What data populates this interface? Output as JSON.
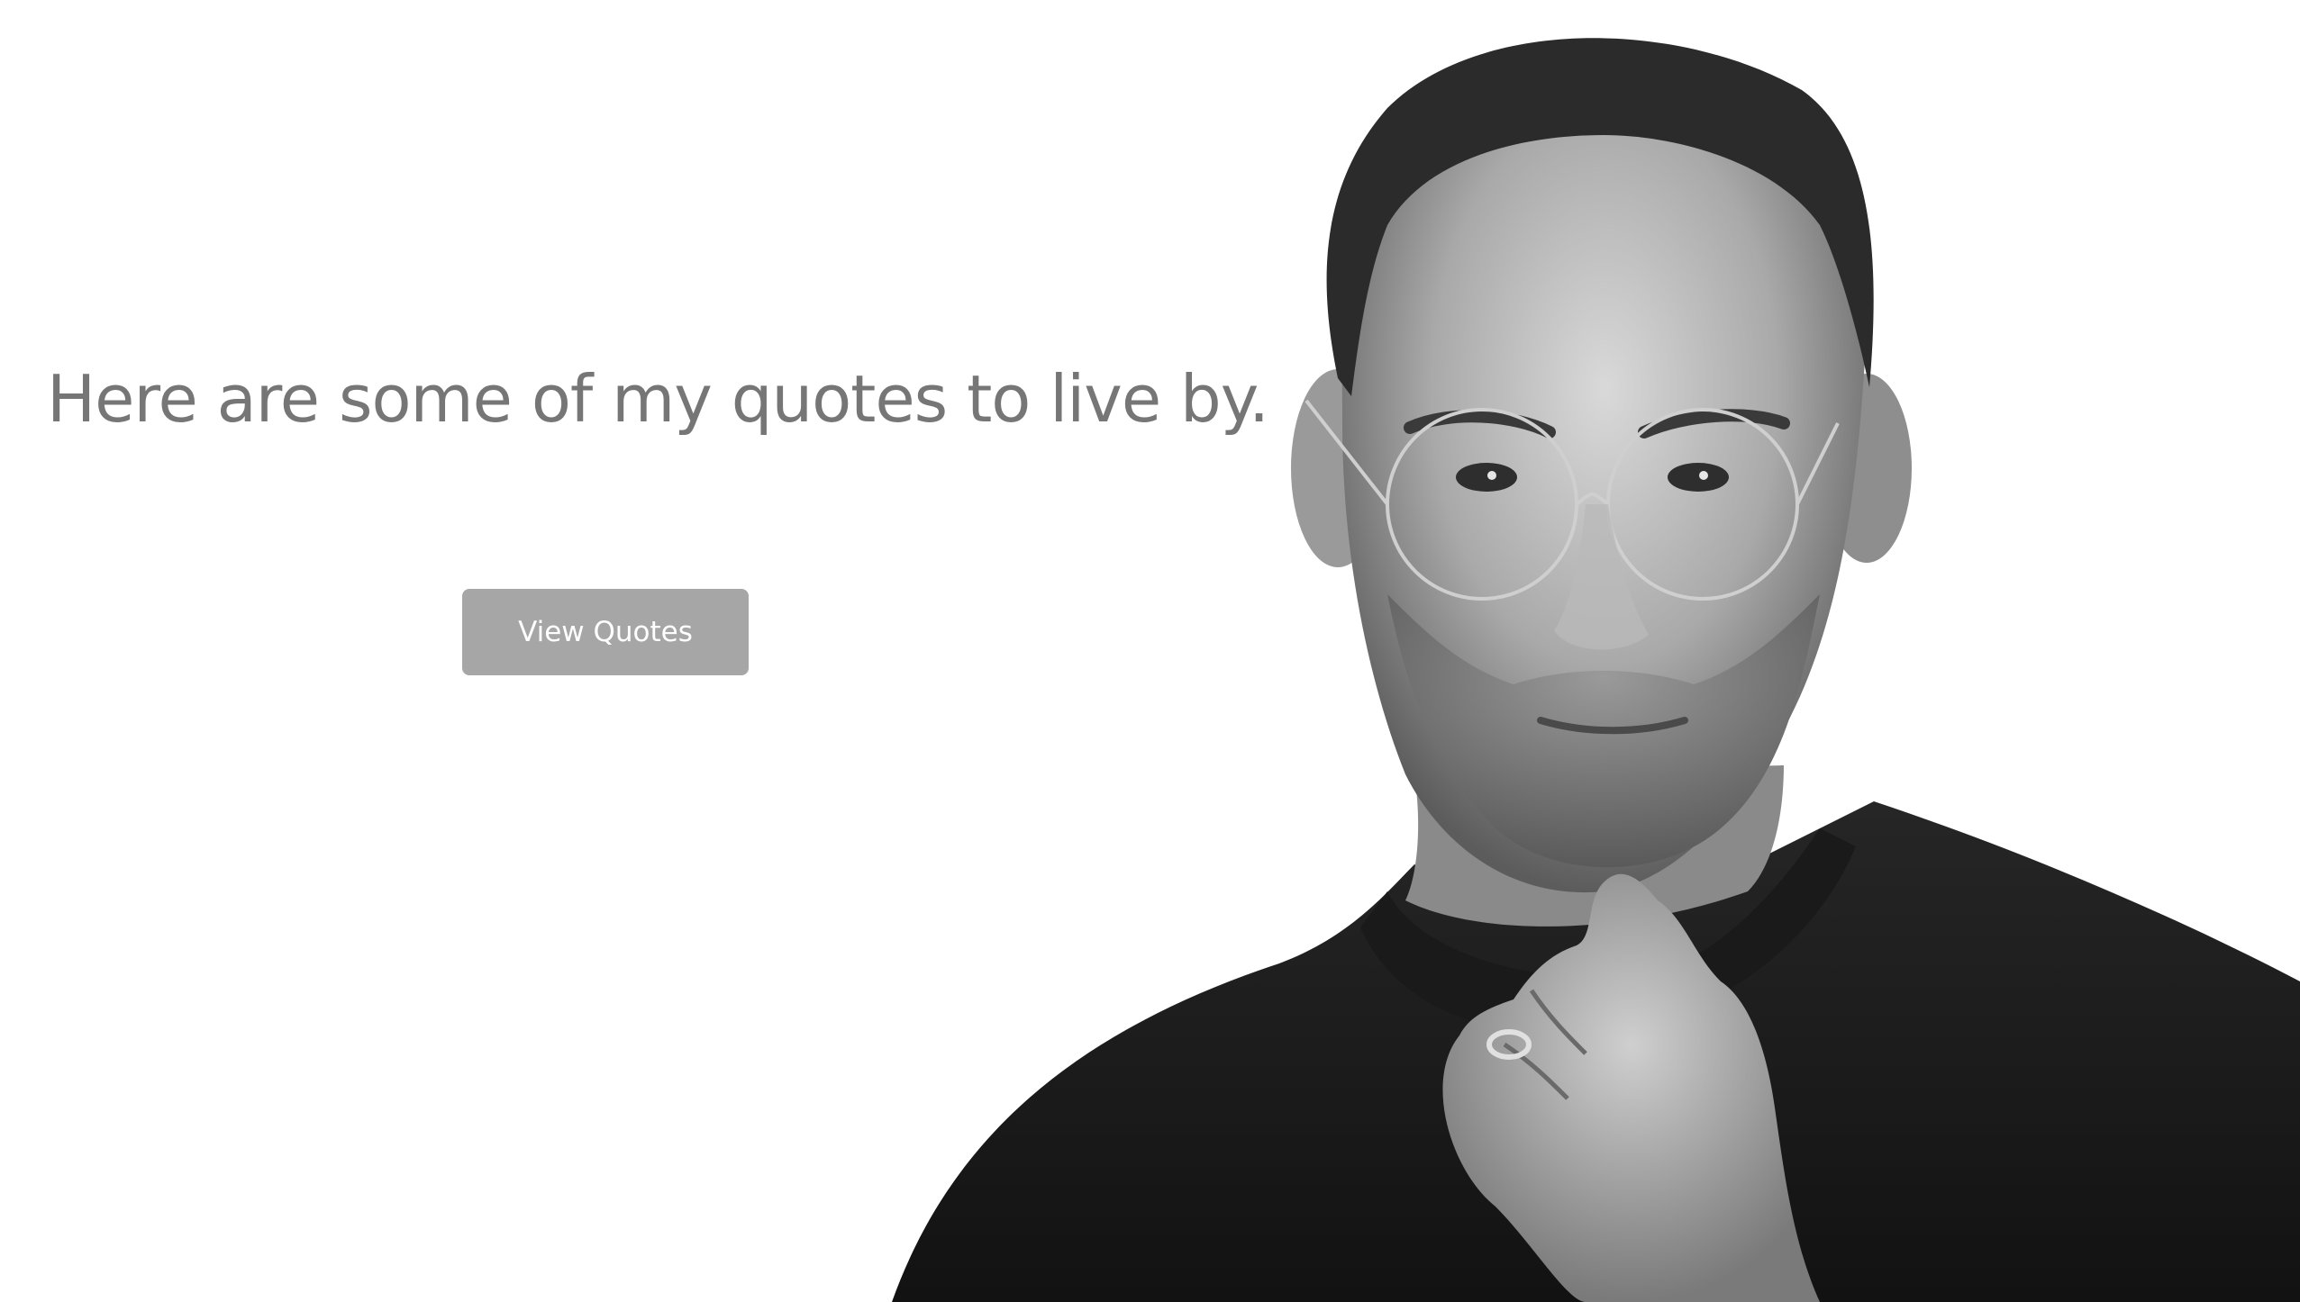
{
  "hero": {
    "heading": "Here are some of my quotes to live by.",
    "button_label": "View Quotes"
  },
  "portrait": {
    "icon": "person-portrait-photo"
  },
  "colors": {
    "heading_text": "#767676",
    "button_bg": "#a6a6a6",
    "button_text": "#ffffff",
    "background": "#ffffff"
  }
}
